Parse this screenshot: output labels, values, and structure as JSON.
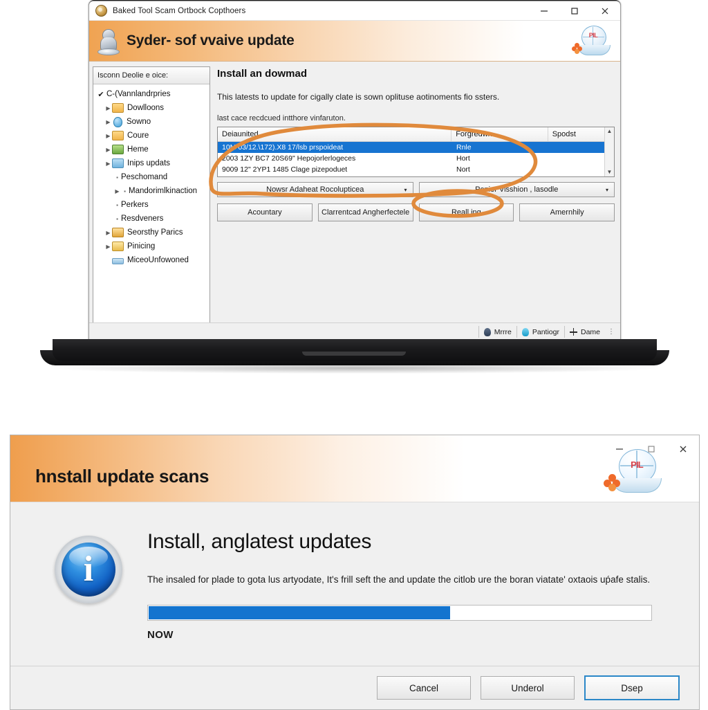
{
  "app_window": {
    "titlebar": {
      "title": "Baked Tool Scam Ortbock Copthoers",
      "icon": "app-gold-icon",
      "minimize": "—",
      "maximize": "□",
      "close": "✕"
    },
    "banner": {
      "title": "Syder- sof vvaive update",
      "left_icon": "chess-pawn-figure-icon",
      "logo_mark": "PIL"
    },
    "sidebar": {
      "header": "Isconn Deolie e oice:",
      "items": [
        {
          "label": "C-(Vannlandrpries",
          "indent": 0,
          "marker": "check",
          "icon": "none"
        },
        {
          "label": "Dowlloons",
          "indent": 1,
          "marker": "arrow",
          "icon": "folder"
        },
        {
          "label": "Sowno",
          "indent": 1,
          "marker": "arrow",
          "icon": "droplet"
        },
        {
          "label": "Coure",
          "indent": 1,
          "marker": "arrow",
          "icon": "folder"
        },
        {
          "label": "Heme",
          "indent": 1,
          "marker": "arrow",
          "icon": "green"
        },
        {
          "label": "Inips updats",
          "indent": 1,
          "marker": "arrow",
          "icon": "blue"
        },
        {
          "label": "Peschomand",
          "indent": 2,
          "marker": "dot",
          "icon": "none"
        },
        {
          "label": "Mandorimlkinaction",
          "indent": 2,
          "marker": "arrow-dot",
          "icon": "none"
        },
        {
          "label": "Perkers",
          "indent": 2,
          "marker": "dot",
          "icon": "none"
        },
        {
          "label": "Resdveners",
          "indent": 2,
          "marker": "dot",
          "icon": "none"
        },
        {
          "label": "Seorsthy Parics",
          "indent": 1,
          "marker": "arrow",
          "icon": "gold"
        },
        {
          "label": "Pinicing",
          "indent": 1,
          "marker": "arrow",
          "icon": "yellow"
        },
        {
          "label": "MiceoUnfowoned",
          "indent": 1,
          "marker": "none",
          "icon": "bar"
        }
      ]
    },
    "content": {
      "heading": "Install an dowmad",
      "paragraph": "This latests to update for cigally clate is sown oplituse aotinoments fio ssters.",
      "subparagraph": "last cace recdcued intthore vinfaruton.",
      "table": {
        "columns": [
          "Deiaunited",
          "Forgredwn",
          "Spodst"
        ],
        "rows": [
          {
            "cells": [
              "10M 03/12.\\172).X8 17/lsb prspoideat",
              "Rnle",
              ""
            ],
            "selected": true
          },
          {
            "cells": [
              "2003 1ZY BC7 20S69\" Hepojorlerlogeces",
              "Hort",
              ""
            ],
            "selected": false
          },
          {
            "cells": [
              "9009 12\" 2YP1 1485 Clage pizepoduet",
              "Nort",
              ""
            ],
            "selected": false
          }
        ],
        "scroll_up": "▲",
        "scroll_down": "▼"
      },
      "combos": [
        {
          "value": "Nowsr Adaheat Rocolupticea",
          "caret": "▾"
        },
        {
          "value": "Pepier Visshion , lasodle",
          "caret": "▾"
        }
      ],
      "buttons": [
        "Acountary",
        "Clarrentcad Angherfectele",
        "Reall ing",
        "Amernhily"
      ]
    },
    "statusbar": {
      "cells": [
        {
          "label": "Mrrre",
          "icon": "nav-pin-icon"
        },
        {
          "label": "Pantiogr",
          "icon": "cyan-drop-icon"
        },
        {
          "label": "Dame",
          "icon": "plus-icon"
        }
      ],
      "overflow": "⋮"
    },
    "annotations": {
      "color": "#e08a3c",
      "shapes": [
        "ellipse-around-table",
        "ellipse-around-second-combo"
      ]
    }
  },
  "dialog": {
    "titlebar": {
      "title": "hnstall update scans",
      "minimize": "—",
      "maximize": "□",
      "close": "✕",
      "logo_mark": "PIL"
    },
    "icon": {
      "name": "info-icon",
      "glyph": "i"
    },
    "heading": "Install, anglatest updates",
    "paragraph": "The insaled for plade to gota lus artyodate, It's frill seft the and update the citlob ure the boran viatateʹ oxtaois uṕafe stalis.",
    "progress": {
      "percent": 60,
      "label": "NOW",
      "fill_color": "#1374cf"
    },
    "buttons": [
      {
        "label": "Cancel",
        "default": false
      },
      {
        "label": "Underol",
        "default": false
      },
      {
        "label": "Dsep",
        "default": true
      }
    ]
  }
}
